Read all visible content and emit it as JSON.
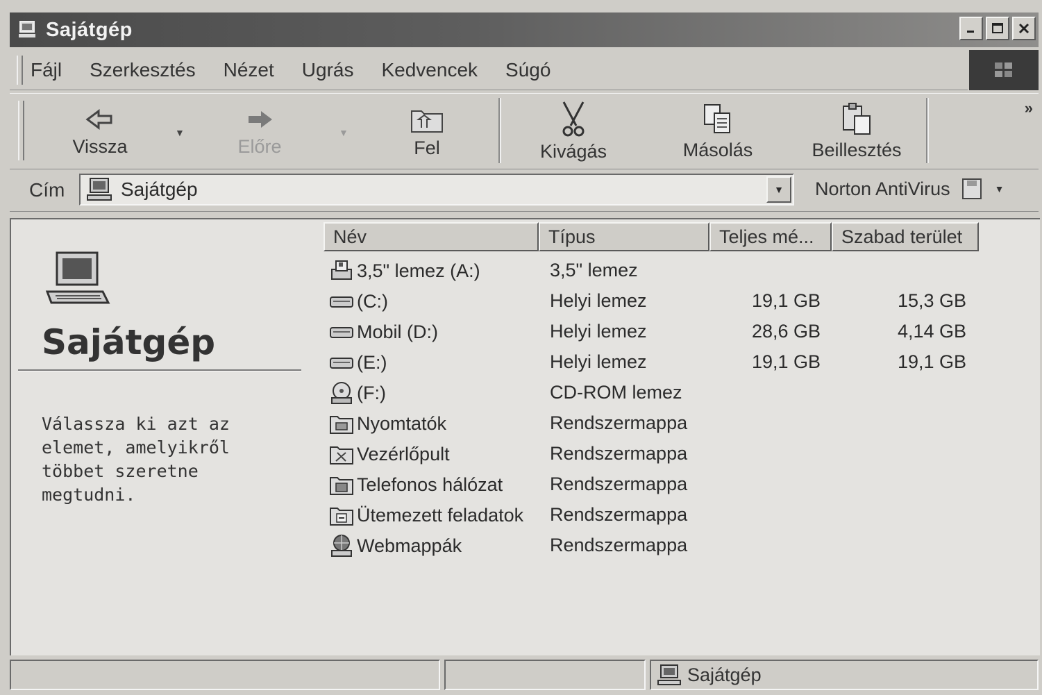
{
  "window": {
    "title": "Sajátgép"
  },
  "menu": [
    "Fájl",
    "Szerkesztés",
    "Nézet",
    "Ugrás",
    "Kedvencek",
    "Súgó"
  ],
  "toolbar": {
    "back": "Vissza",
    "forward": "Előre",
    "up": "Fel",
    "cut": "Kivágás",
    "copy": "Másolás",
    "paste": "Beillesztés"
  },
  "address": {
    "label": "Cím",
    "value": "Sajátgép",
    "norton": "Norton AntiVirus"
  },
  "leftpane": {
    "title": "Sajátgép",
    "description": "Válassza ki azt az elemet, amelyikről többet szeretne megtudni."
  },
  "columns": [
    "Név",
    "Típus",
    "Teljes mé...",
    "Szabad terület"
  ],
  "items": [
    {
      "name": "3,5\" lemez (A:)",
      "type": "3,5\" lemez",
      "total": "",
      "free": "",
      "icon": "floppy-icon"
    },
    {
      "name": "(C:)",
      "type": "Helyi lemez",
      "total": "19,1 GB",
      "free": "15,3 GB",
      "icon": "hard-drive-icon"
    },
    {
      "name": "Mobil (D:)",
      "type": "Helyi lemez",
      "total": "28,6 GB",
      "free": "4,14 GB",
      "icon": "hard-drive-icon"
    },
    {
      "name": "(E:)",
      "type": "Helyi lemez",
      "total": "19,1 GB",
      "free": "19,1 GB",
      "icon": "hard-drive-icon"
    },
    {
      "name": "(F:)",
      "type": "CD-ROM lemez",
      "total": "",
      "free": "",
      "icon": "cdrom-icon"
    },
    {
      "name": "Nyomtatók",
      "type": "Rendszermappa",
      "total": "",
      "free": "",
      "icon": "printers-folder-icon"
    },
    {
      "name": "Vezérlőpult",
      "type": "Rendszermappa",
      "total": "",
      "free": "",
      "icon": "control-panel-icon"
    },
    {
      "name": "Telefonos hálózat",
      "type": "Rendszermappa",
      "total": "",
      "free": "",
      "icon": "dialup-network-icon"
    },
    {
      "name": "Ütemezett feladatok",
      "type": "Rendszermappa",
      "total": "",
      "free": "",
      "icon": "scheduled-tasks-icon"
    },
    {
      "name": "Webmappák",
      "type": "Rendszermappa",
      "total": "",
      "free": "",
      "icon": "web-folders-icon"
    }
  ],
  "status": {
    "location": "Sajátgép"
  }
}
